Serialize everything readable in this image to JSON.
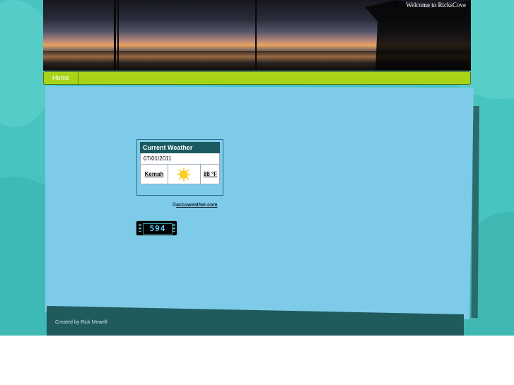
{
  "header": {
    "welcome": "Welcome to RicksCove"
  },
  "nav": {
    "items": [
      {
        "label": "Home"
      }
    ]
  },
  "weather_widget": {
    "title": "Current Weather",
    "date": "07/01/2011",
    "city": "Kemah",
    "condition_icon": "sun-icon",
    "temperature": "88 °F"
  },
  "accuweather": {
    "symbol": "©",
    "link_label": "accuweather.com"
  },
  "hit_counter": {
    "value": "594"
  },
  "footer": {
    "credit": "Created by Rick Mowell"
  },
  "colors": {
    "background": "#48c4c0",
    "content": "#7ecbe9",
    "nav": "#a8d418",
    "footer": "#1f5a5c",
    "weather_header": "#1a5a60"
  }
}
